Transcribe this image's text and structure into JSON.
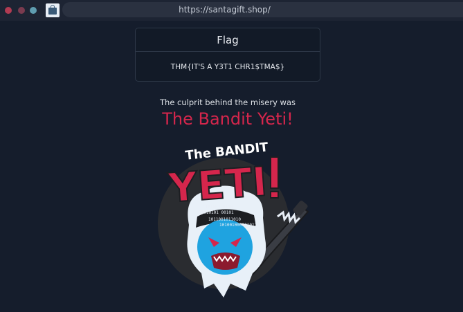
{
  "browser": {
    "url": "https://santagift.shop/",
    "favicon": "shopping-bag-icon"
  },
  "flag_card": {
    "title": "Flag",
    "value": "THM{IT'S A Y3T1 CHR1$TMA$}"
  },
  "reveal": {
    "text": "The culprit behind the misery was",
    "name": "The Bandit Yeti!"
  },
  "logo": {
    "top_text": "The BANDIT",
    "main_text": "YETI",
    "binary_lines": [
      "1101001 0110",
      "01010101 00101",
      "1011001011010",
      "1010010001010110"
    ]
  },
  "colors": {
    "background": "#151d2c",
    "accent": "#d5264c",
    "yeti_blue": "#1fa3e0"
  }
}
